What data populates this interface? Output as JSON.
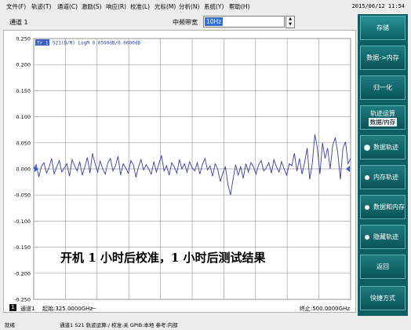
{
  "menu": {
    "items": [
      "文件(F)",
      "轨迹(T)",
      "通道(C)",
      "激励(S)",
      "响应(R)",
      "校准(L)",
      "光标(M)",
      "分析(N)",
      "系统(Y)",
      "帮助(H)"
    ],
    "clock": "2015/06/12 11:54"
  },
  "toolbar": {
    "channel": "通道 1",
    "ifbw_label": "中频带宽",
    "ifbw_value": "10Hz"
  },
  "trace_header": {
    "tag": "Tr 1",
    "text": "S21(D/M) LogM 0.0500dB/0.0000dB"
  },
  "chart_data": {
    "type": "line",
    "ylim": [
      -0.25,
      0.25
    ],
    "yticks": [
      "0.250",
      "0.200",
      "0.150",
      "0.100",
      "0.050",
      "0.000",
      "-0.050",
      "-0.100",
      "-0.150",
      "-0.200",
      "-0.250"
    ],
    "xlim": [
      325,
      500
    ],
    "series": [
      {
        "color": "#3a3a9e",
        "values": [
          0.0,
          0.008,
          -0.015,
          0.005,
          0.012,
          -0.008,
          0.003,
          0.02,
          -0.01,
          0.004,
          0.016,
          -0.006,
          0.002,
          0.01,
          -0.014,
          0.018,
          0.006,
          -0.004,
          0.014,
          -0.012,
          0.004,
          0.022,
          -0.008,
          0.03,
          0.01,
          -0.006,
          0.015,
          0.0,
          -0.01,
          0.012,
          0.02,
          -0.004,
          0.006,
          0.024,
          -0.012,
          0.01,
          0.002,
          -0.008,
          0.016,
          0.008,
          -0.016,
          0.004,
          0.018,
          -0.002,
          0.008,
          0.0,
          -0.01,
          0.014,
          -0.006,
          0.01,
          0.026,
          -0.004,
          0.006,
          -0.012,
          0.012,
          0.004,
          -0.008,
          0.018,
          0.0,
          0.01,
          -0.006,
          0.014,
          0.002,
          -0.004,
          0.012,
          -0.01,
          0.008,
          0.02,
          -0.002,
          0.006,
          -0.014,
          0.01,
          0.0,
          -0.024,
          -0.008,
          0.004,
          -0.03,
          -0.05,
          -0.02,
          0.008,
          -0.012,
          0.004,
          -0.018,
          0.01,
          -0.006,
          0.012,
          0.004,
          -0.01,
          0.008,
          0.016,
          -0.004,
          0.002,
          0.012,
          -0.008,
          0.018,
          0.004,
          -0.006,
          0.014,
          0.0,
          -0.012,
          0.01,
          0.006,
          0.03,
          -0.004,
          0.02,
          -0.01,
          0.012,
          0.04,
          -0.02,
          0.01,
          0.066,
          0.04,
          -0.01,
          0.05,
          0.02,
          0.04,
          0.0,
          0.045,
          0.06,
          0.03,
          -0.02,
          0.04,
          0.052,
          0.01,
          0.02
        ]
      }
    ]
  },
  "annotation": "开机 1 小时后校准，1 小时后测试结果",
  "footer": {
    "channel_num": "1",
    "channel_label": "通道1",
    "start": "起始:325.0000GHz",
    "stop": "终止:500.0000GHz"
  },
  "status": {
    "left": "就绪",
    "text": "通道1  S21  轨迹运算:/  校准:关  GPIB:本地  参考:内部"
  },
  "softkeys": {
    "title": "存储",
    "data_to_mem": "数据->内存",
    "normalize": "归一化",
    "trace_math_line1": "轨迹运算",
    "trace_math_line2": "数据/内存",
    "data_trace": "数据轨迹",
    "mem_trace": "内存轨迹",
    "data_and_mem": "数据和内存",
    "hide_trace": "隐藏轨迹",
    "back": "返回",
    "quick": "快捷方式"
  }
}
